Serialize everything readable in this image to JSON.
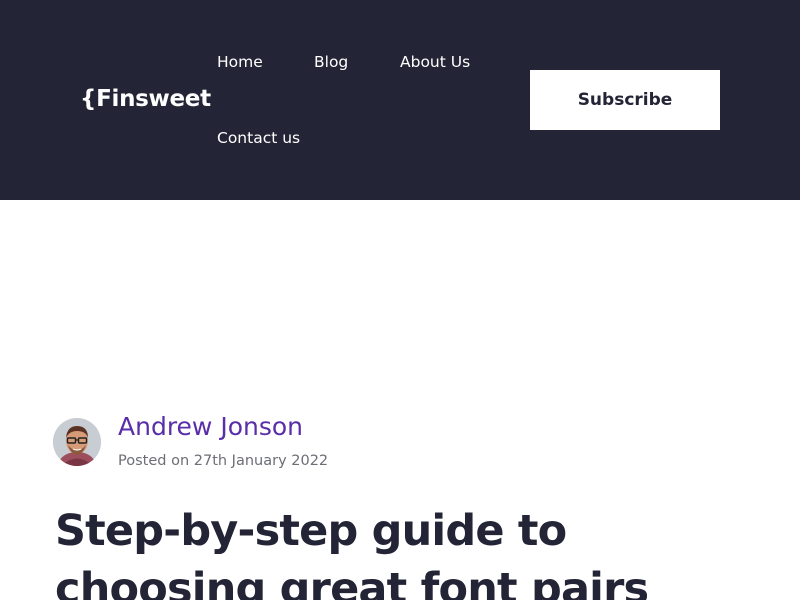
{
  "header": {
    "logo_text": "{Finsweet",
    "nav": {
      "home": "Home",
      "blog": "Blog",
      "about": "About Us",
      "contact": "Contact us"
    },
    "subscribe_label": "Subscribe"
  },
  "post": {
    "author_name": "Andrew Jonson",
    "posted_on": "Posted on 27th January 2022",
    "title": "Step-by-step guide to choosing great font pairs"
  },
  "colors": {
    "header_bg": "#232536",
    "accent_purple": "#592EA9",
    "text_dark": "#232536",
    "text_muted": "#6D6E76"
  },
  "icons": {
    "avatar": "author-photo"
  }
}
